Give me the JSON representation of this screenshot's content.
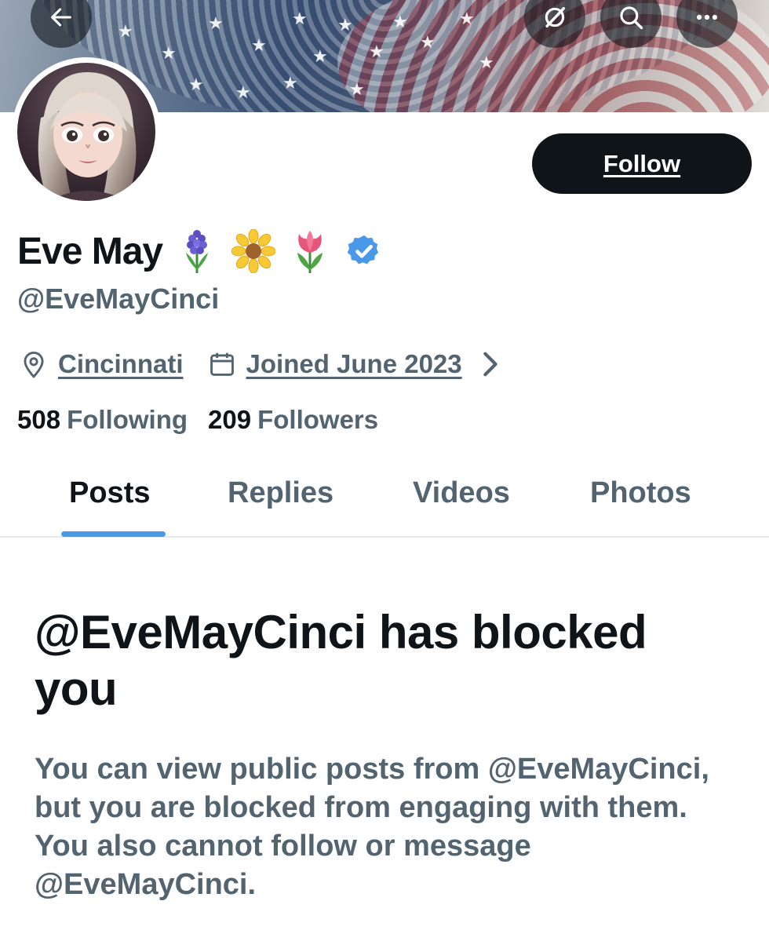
{
  "header": {
    "back_icon": "arrow-left-icon",
    "grok_icon": "grok-icon",
    "search_icon": "search-icon",
    "more_icon": "more-horizontal-icon"
  },
  "profile": {
    "display_name": "Eve May",
    "emojis": [
      "hyacinth",
      "blossom",
      "tulip"
    ],
    "verified_icon": "verified-badge-icon",
    "verified_color": "#4a99e9",
    "handle": "@EveMayCinci",
    "follow_label": "Follow",
    "location": "Cincinnati",
    "joined": "Joined June 2023",
    "following_count": "508",
    "following_label": "Following",
    "followers_count": "209",
    "followers_label": "Followers"
  },
  "tabs": [
    {
      "label": "Posts",
      "active": true
    },
    {
      "label": "Replies",
      "active": false
    },
    {
      "label": "Videos",
      "active": false
    },
    {
      "label": "Photos",
      "active": false
    }
  ],
  "blocked": {
    "title": "@EveMayCinci has blocked you",
    "message": "You can view public posts from @EveMayCinci, but you are blocked from engaging with them. You also cannot follow or message @EveMayCinci."
  },
  "colors": {
    "text_primary": "#0f1419",
    "text_secondary": "#536471",
    "accent": "#4a99e9"
  }
}
